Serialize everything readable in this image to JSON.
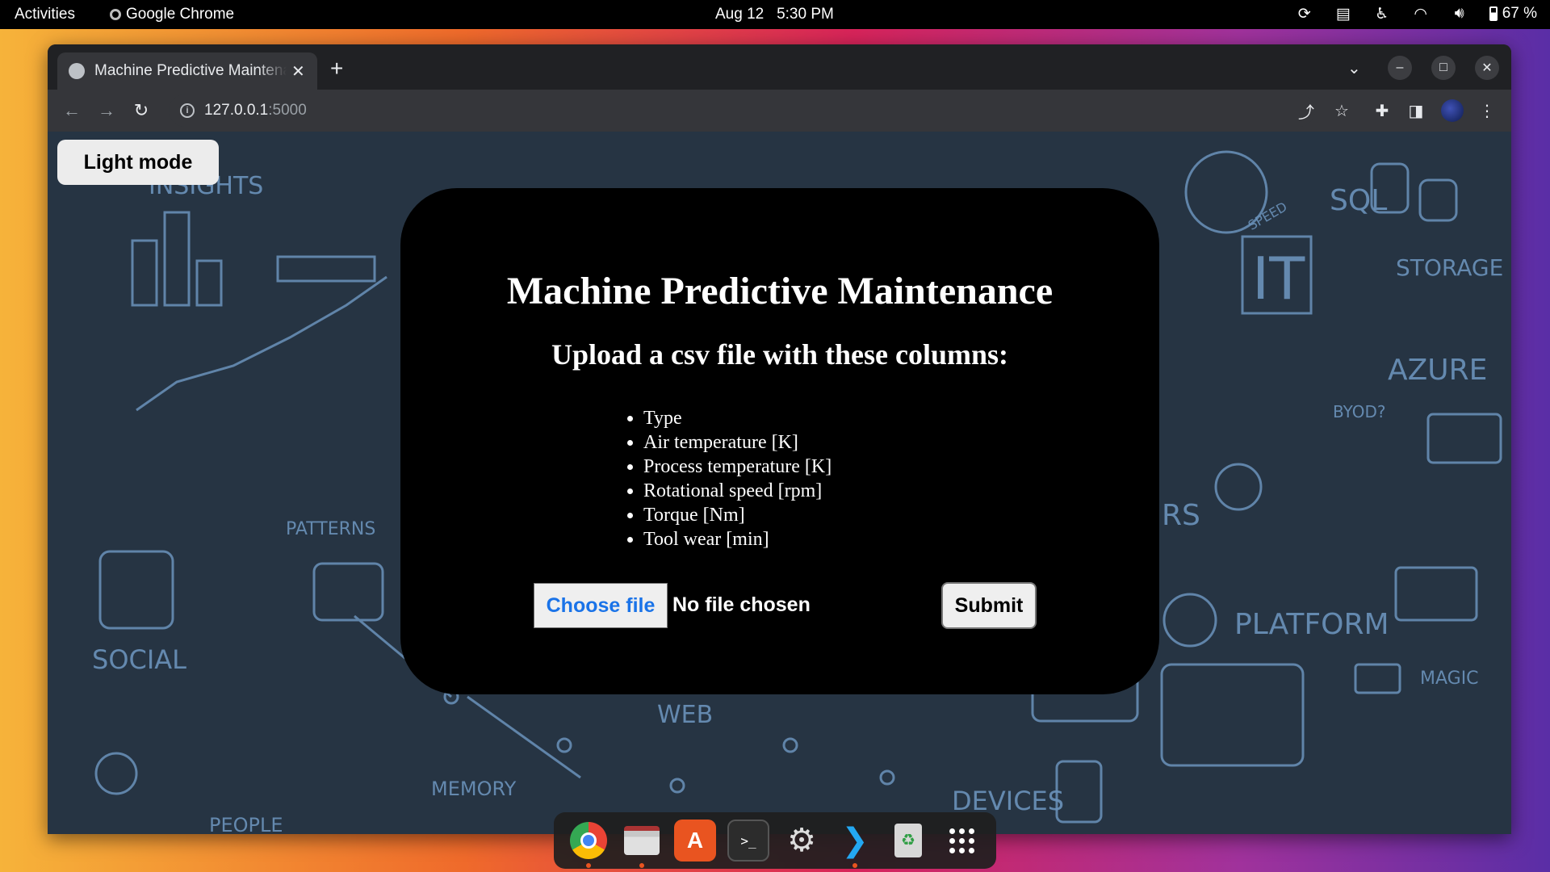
{
  "topbar": {
    "activities": "Activities",
    "app_name": "Google Chrome",
    "date": "Aug 12",
    "time": "5:30 PM",
    "battery": "67 %"
  },
  "browser": {
    "tab_title": "Machine Predictive Maintenance",
    "url_host": "127.0.0.1",
    "url_port": ":5000"
  },
  "page": {
    "mode_toggle_label": "Light mode",
    "title": "Machine Predictive Maintenance",
    "subtitle": "Upload a csv file with these columns:",
    "columns": [
      "Type",
      "Air temperature [K]",
      "Process temperature [K]",
      "Rotational speed [rpm]",
      "Torque [Nm]",
      "Tool wear [min]"
    ],
    "choose_file_label": "Choose file",
    "no_file_text": "No file chosen",
    "submit_label": "Submit"
  },
  "background_doodles": {
    "insights": "INSIGHTS",
    "patterns": "PATTERNS",
    "social": "SOCIAL",
    "memory": "MEMORY",
    "sql": "SQL",
    "storage": "STORAGE",
    "it": "IT",
    "azure": "AZURE",
    "byod": "BYOD?",
    "platform": "PLATFORM",
    "magic": "MAGIC",
    "devices": "DEVICES",
    "speed": "SPEED",
    "web": "WEB",
    "people": "PEOPLE",
    "rs": "RS"
  },
  "dock": [
    "chrome-icon",
    "files-icon",
    "app-center-icon",
    "terminal-icon",
    "settings-icon",
    "vscode-icon",
    "trash-icon",
    "app-grid-icon"
  ]
}
